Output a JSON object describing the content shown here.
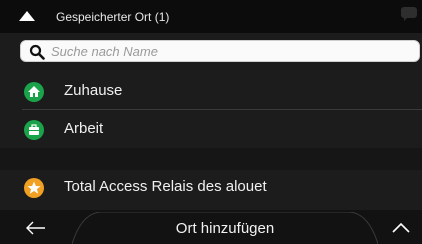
{
  "header": {
    "title": "Gespeicherter Ort (1)"
  },
  "search": {
    "placeholder": "Suche nach Name"
  },
  "places": [
    {
      "label": "Zuhause",
      "icon": "home-icon",
      "color": "#1aa34a"
    },
    {
      "label": "Arbeit",
      "icon": "briefcase-icon",
      "color": "#1aa34a"
    },
    {
      "label": "Total Access Relais des alouet",
      "icon": "star-icon",
      "color": "#f0a022"
    }
  ],
  "bottom_bar": {
    "add_label": "Ort hinzufügen"
  },
  "colors": {
    "background": "#1c1c1c",
    "accent_green": "#1aa34a",
    "accent_orange": "#f0a022"
  }
}
